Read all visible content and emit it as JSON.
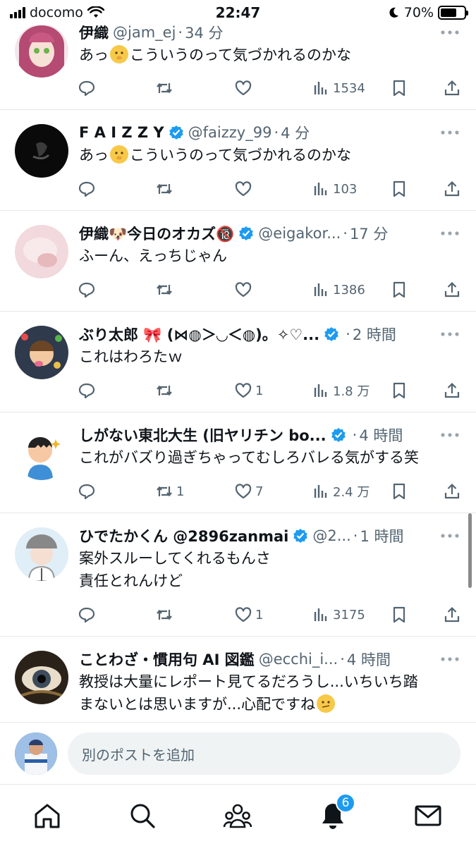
{
  "status_bar": {
    "carrier": "docomo",
    "time": "22:47",
    "battery": "70%",
    "battery_level": 0.7
  },
  "posts": [
    {
      "display_name": "伊織",
      "handle": "@jam_ej",
      "time": "34 分",
      "verified": false,
      "text_before_emoji": "あっ",
      "emoji": "shushing-face",
      "text_after_emoji": "こういうのって気づかれるのかな",
      "text_line2": "",
      "replies": "",
      "reposts": "",
      "likes": "",
      "views": "1534"
    },
    {
      "display_name": "F A I Z Z Y",
      "handle": "@faizzy_99",
      "time": "4 分",
      "verified": true,
      "text_before_emoji": "あっ",
      "emoji": "shushing-face",
      "text_after_emoji": "こういうのって気づかれるのかな",
      "text_line2": "",
      "replies": "",
      "reposts": "",
      "likes": "",
      "views": "103"
    },
    {
      "display_name": "伊織🐶今日のオカズ🔞",
      "handle": "@eigakor...",
      "time": "17 分",
      "verified": true,
      "text_before_emoji": "ふーん、えっちじゃん",
      "emoji": "",
      "text_after_emoji": "",
      "text_line2": "",
      "replies": "",
      "reposts": "",
      "likes": "",
      "views": "1386"
    },
    {
      "display_name": "ぶり太郎 🎀 (⋈◍＞◡＜◍)。✧♡...",
      "handle": "",
      "time": "2 時間",
      "verified": true,
      "text_before_emoji": "これはわろたｗ",
      "emoji": "",
      "text_after_emoji": "",
      "text_line2": "",
      "replies": "",
      "reposts": "",
      "likes": "1",
      "views": "1.8 万"
    },
    {
      "display_name": "しがない東北大生 (旧ヤリチン bo...",
      "handle": "",
      "time": "4 時間",
      "verified": true,
      "text_before_emoji": "これがバズり過ぎちゃってむしろバレる気がする笑",
      "emoji": "",
      "text_after_emoji": "",
      "text_line2": "",
      "replies": "",
      "reposts": "1",
      "likes": "7",
      "views": "2.4 万"
    },
    {
      "display_name": "ひでたかくん @2896zanmai",
      "handle": "@2...",
      "time": "1 時間",
      "verified": true,
      "text_before_emoji": "案外スルーしてくれるもんさ",
      "emoji": "",
      "text_after_emoji": "",
      "text_line2": "責任とれんけど",
      "replies": "",
      "reposts": "",
      "likes": "1",
      "views": "3175"
    },
    {
      "display_name": "ことわざ・慣用句 AI 図鑑",
      "handle": "@ecchi_i...",
      "time": "4 時間",
      "verified": false,
      "text_before_emoji": "教授は大量にレポート見てるだろうし...いちいち踏",
      "emoji": "",
      "text_after_emoji": "",
      "text_line2": "まないとは思いますが...心配ですね",
      "emoji2": "confused-face",
      "replies": "",
      "reposts": "",
      "likes": "",
      "views": ""
    }
  ],
  "compose": {
    "placeholder": "別のポストを追加"
  },
  "nav": {
    "notification_count": "6"
  },
  "colors": {
    "accent": "#1d9bf0",
    "text_primary": "#0f1419",
    "text_secondary": "#536471",
    "divider": "#e6e8eb"
  }
}
